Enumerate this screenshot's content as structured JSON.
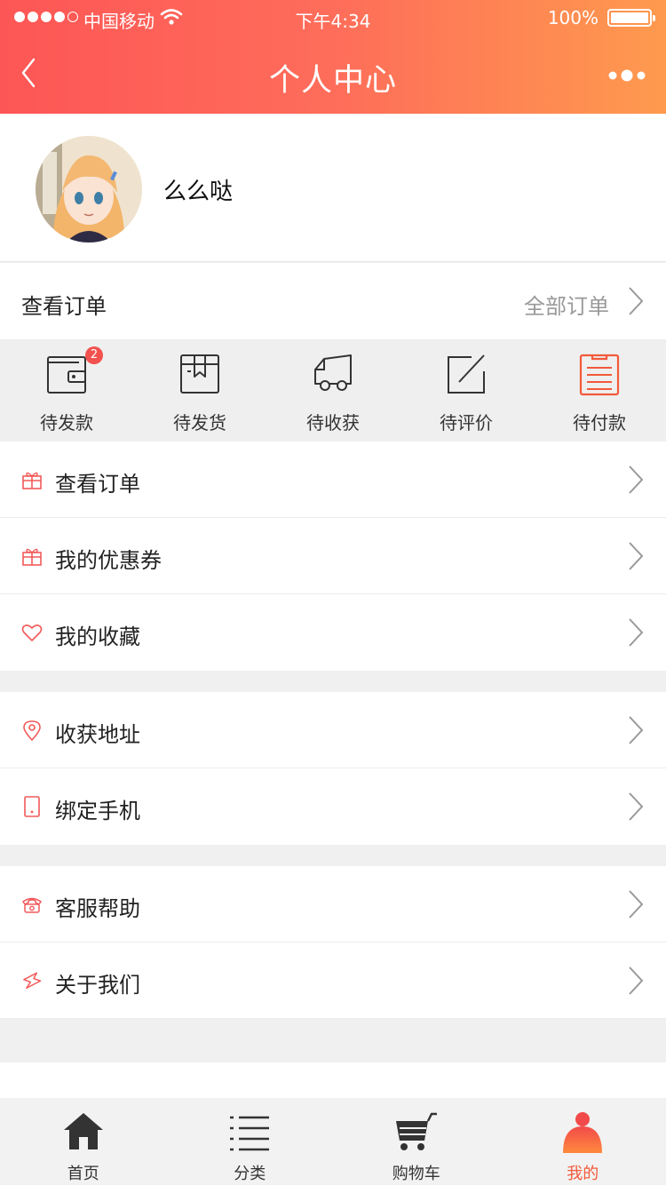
{
  "status_bar": {
    "carrier": "中国移动",
    "time": "下午4:34",
    "battery": "100%"
  },
  "nav": {
    "title": "个人中心"
  },
  "profile": {
    "username": "么么哒"
  },
  "orders": {
    "title": "查看订单",
    "all_label": "全部订单"
  },
  "order_status": [
    {
      "label": "待发款",
      "icon": "wallet-icon",
      "badge": "2"
    },
    {
      "label": "待发货",
      "icon": "package-icon"
    },
    {
      "label": "待收获",
      "icon": "delivery-cart-icon"
    },
    {
      "label": "待评价",
      "icon": "edit-icon"
    },
    {
      "label": "待付款",
      "icon": "clipboard-icon"
    }
  ],
  "menu_group_1": [
    {
      "label": "查看订单",
      "icon": "gift-icon"
    },
    {
      "label": "我的优惠券",
      "icon": "gift-icon"
    },
    {
      "label": "我的收藏",
      "icon": "heart-icon"
    }
  ],
  "menu_group_2": [
    {
      "label": "收获地址",
      "icon": "location-pin-icon"
    },
    {
      "label": "绑定手机",
      "icon": "phone-icon"
    }
  ],
  "menu_group_3": [
    {
      "label": "客服帮助",
      "icon": "telephone-icon"
    },
    {
      "label": "关于我们",
      "icon": "lightning-icon"
    }
  ],
  "tabbar": [
    {
      "label": "首页",
      "icon": "home-icon"
    },
    {
      "label": "分类",
      "icon": "list-icon"
    },
    {
      "label": "购物车",
      "icon": "cart-icon"
    },
    {
      "label": "我的",
      "icon": "user-icon",
      "active": true
    }
  ],
  "colors": {
    "accent": "#fd5656",
    "accent_end": "#fe9a4e",
    "icon_red": "#f25a5a",
    "tab_active": "#f25a3a"
  }
}
